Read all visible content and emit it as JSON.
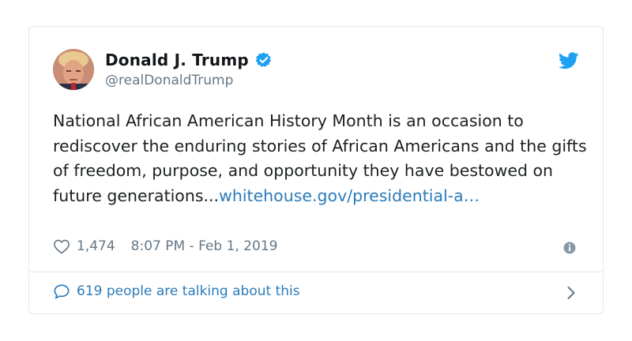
{
  "author": {
    "display_name": "Donald J. Trump",
    "handle": "@realDonaldTrump",
    "verified": true
  },
  "tweet": {
    "text": "National African American History Month is an occasion to rediscover the enduring stories of African Americans and the gifts of freedom, purpose, and opportunity they have bestowed on future generations...",
    "link": "whitehouse.gov/presidential-a…"
  },
  "meta": {
    "likes": "1,474",
    "timestamp": "8:07 PM - Feb 1, 2019"
  },
  "footer": {
    "talking": "619 people are talking about this"
  },
  "colors": {
    "link": "#2b7bb9",
    "verified": "#1da1f2",
    "muted": "#657786",
    "border": "#e1e8ed"
  },
  "icons": [
    "avatar",
    "verified-badge-icon",
    "twitter-bird-icon",
    "heart-icon",
    "info-icon",
    "speech-bubble-icon",
    "chevron-right-icon"
  ]
}
